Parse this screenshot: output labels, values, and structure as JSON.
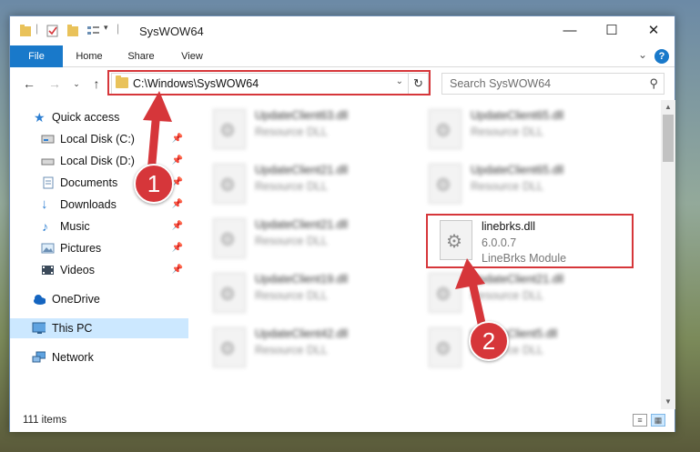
{
  "window": {
    "title": "SysWOW64"
  },
  "ribbon": {
    "tabs": [
      "File",
      "Home",
      "Share",
      "View"
    ],
    "help": "?"
  },
  "address": {
    "path": "C:\\Windows\\SysWOW64"
  },
  "search": {
    "placeholder": "Search SysWOW64"
  },
  "sidebar": {
    "items": [
      {
        "label": "Quick access",
        "icon": "star-icon"
      },
      {
        "label": "Local Disk (C:)",
        "icon": "drive-icon"
      },
      {
        "label": "Local Disk (D:)",
        "icon": "drive-icon"
      },
      {
        "label": "Documents",
        "icon": "documents-icon"
      },
      {
        "label": "Downloads",
        "icon": "download-icon"
      },
      {
        "label": "Music",
        "icon": "music-icon"
      },
      {
        "label": "Pictures",
        "icon": "pictures-icon"
      },
      {
        "label": "Videos",
        "icon": "videos-icon"
      },
      {
        "label": "OneDrive",
        "icon": "cloud-icon"
      },
      {
        "label": "This PC",
        "icon": "computer-icon",
        "selected": true
      },
      {
        "label": "Network",
        "icon": "network-icon"
      }
    ]
  },
  "files": [
    {
      "name": "UpdateClient63.dll",
      "type": "Resource DLL",
      "blurred": true
    },
    {
      "name": "UpdateClient65.dll",
      "type": "Resource DLL",
      "blurred": true
    },
    {
      "name": "UpdateClient21.dll",
      "type": "Resource DLL",
      "blurred": true
    },
    {
      "name": "UpdateClient65.dll",
      "type": "Resource DLL",
      "blurred": true
    },
    {
      "name": "UpdateClient21.dll",
      "type": "Resource DLL",
      "blurred": true
    },
    {
      "name": "linebrks.dll",
      "version": "6.0.0.7",
      "type": "LineBrks Module",
      "blurred": false
    },
    {
      "name": "UpdateClient19.dll",
      "type": "Resource DLL",
      "blurred": true
    },
    {
      "name": "UpdateClient21.dll",
      "type": "Resource DLL",
      "blurred": true
    },
    {
      "name": "UpdateClient42.dll",
      "type": "Resource DLL",
      "blurred": true
    },
    {
      "name": "UpdateClient5.dll",
      "type": "Resource DLL",
      "blurred": true
    }
  ],
  "status": {
    "item_count": "111 items"
  },
  "annotations": {
    "step1": "1",
    "step2": "2",
    "color": "#d6363a"
  }
}
